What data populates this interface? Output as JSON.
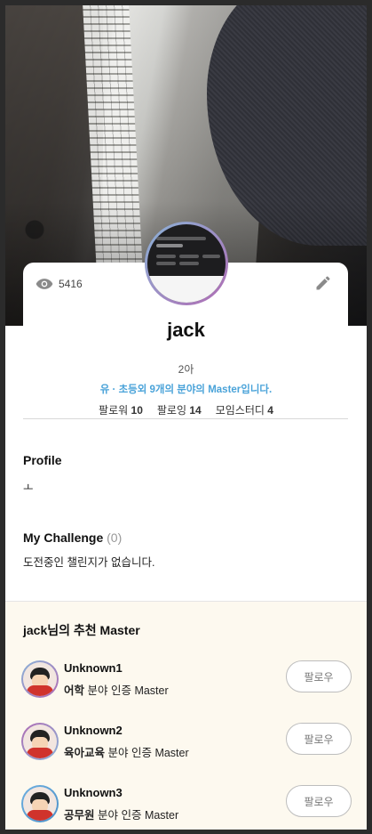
{
  "profile": {
    "views": "5416",
    "name": "jack",
    "grade": "2아",
    "master_line": "유 · 초등외 9개의 분야의 Master입니다.",
    "follower_label": "팔로워",
    "follower_count": "10",
    "following_label": "팔로잉",
    "following_count": "14",
    "study_label": "모임스터디",
    "study_count": "4"
  },
  "sections": {
    "profile_title": "Profile",
    "profile_text": "ㅗ",
    "challenge_title": "My Challenge",
    "challenge_count": "(0)",
    "challenge_empty": "도전중인 챌린지가 없습니다."
  },
  "recommend": {
    "title": "jack님의 추천 Master",
    "items": [
      {
        "name": "Unknown1",
        "field": "어학",
        "suffix": "분야 인증 Master",
        "button": "팔로우"
      },
      {
        "name": "Unknown2",
        "field": "육아교육",
        "suffix": "분야 인증 Master",
        "button": "팔로우"
      },
      {
        "name": "Unknown3",
        "field": "공무원",
        "suffix": "분야 인증 Master",
        "button": "팔로우"
      }
    ]
  },
  "icons": {
    "views": "eye-icon",
    "edit": "pencil-icon"
  },
  "colors": {
    "accent": "#4aa3d9",
    "reco_bg": "#fdf9ef"
  }
}
